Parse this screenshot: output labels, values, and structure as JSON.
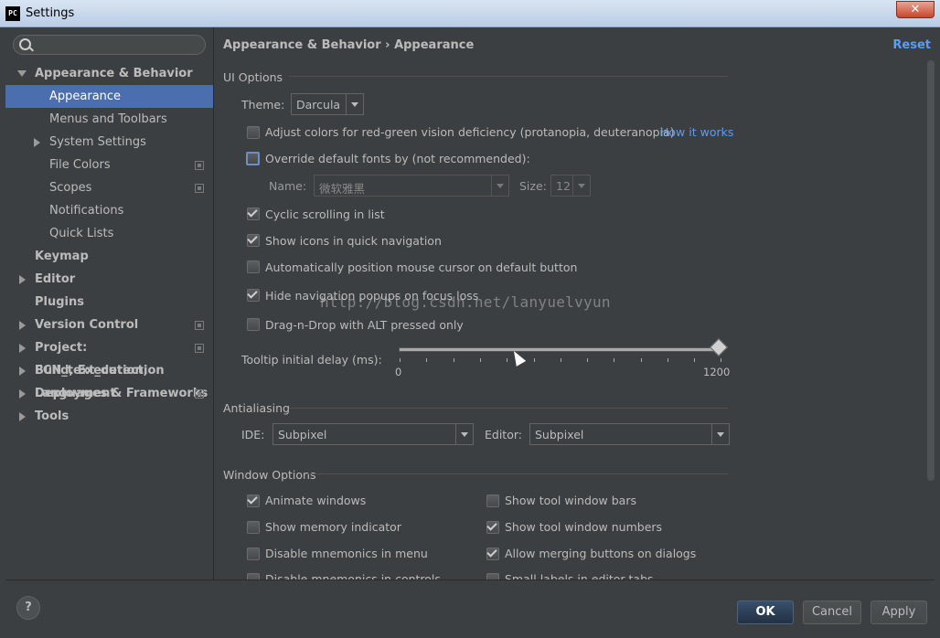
{
  "window": {
    "title": "Settings",
    "app_icon": "PC"
  },
  "sidebar": {
    "search_placeholder": "",
    "items": [
      {
        "label": "Appearance & Behavior"
      },
      {
        "label": "Appearance"
      },
      {
        "label": "Menus and Toolbars"
      },
      {
        "label": "System Settings"
      },
      {
        "label": "File Colors"
      },
      {
        "label": "Scopes"
      },
      {
        "label": "Notifications"
      },
      {
        "label": "Quick Lists"
      },
      {
        "label": "Keymap"
      },
      {
        "label": "Editor"
      },
      {
        "label": "Plugins"
      },
      {
        "label": "Version Control"
      },
      {
        "label": "Project: FCN_text_detection"
      },
      {
        "label": "Build, Execution, Deployment"
      },
      {
        "label": "Languages & Frameworks"
      },
      {
        "label": "Tools"
      }
    ]
  },
  "header": {
    "crumb1": "Appearance & Behavior",
    "crumb_sep": "›",
    "crumb2": "Appearance",
    "reset": "Reset"
  },
  "ui_options": {
    "title": "UI Options",
    "theme_label": "Theme:",
    "theme_value": "Darcula",
    "adjust_colors": "Adjust colors for red-green vision deficiency (protanopia, deuteranopia)",
    "how_it_works": "How it works",
    "override_fonts": "Override default fonts by (not recommended):",
    "name_label": "Name:",
    "name_value": "微软雅黑",
    "size_label": "Size:",
    "size_value": "12",
    "cyclic": "Cyclic scrolling in list",
    "show_icons": "Show icons in quick navigation",
    "auto_position": "Automatically position mouse cursor on default button",
    "hide_popups": "Hide navigation popups on focus loss",
    "drag_drop": "Drag-n-Drop with ALT pressed only",
    "tooltip_label": "Tooltip initial delay (ms):",
    "slider_min": "0",
    "slider_max": "1200",
    "slider_value": 1200
  },
  "antialiasing": {
    "title": "Antialiasing",
    "ide_label": "IDE:",
    "ide_value": "Subpixel",
    "editor_label": "Editor:",
    "editor_value": "Subpixel"
  },
  "window_options": {
    "title": "Window Options",
    "animate": "Animate windows",
    "memory": "Show memory indicator",
    "mnemonics_menu": "Disable mnemonics in menu",
    "mnemonics_controls": "Disable mnemonics in controls",
    "tool_bars": "Show tool window bars",
    "tool_numbers": "Show tool window numbers",
    "merge_buttons": "Allow merging buttons on dialogs",
    "small_labels": "Small labels in editor tabs"
  },
  "footer": {
    "help": "?",
    "ok": "OK",
    "cancel": "Cancel",
    "apply": "Apply"
  },
  "watermark": "http://blog.csdn.net/lanyuelvyun"
}
